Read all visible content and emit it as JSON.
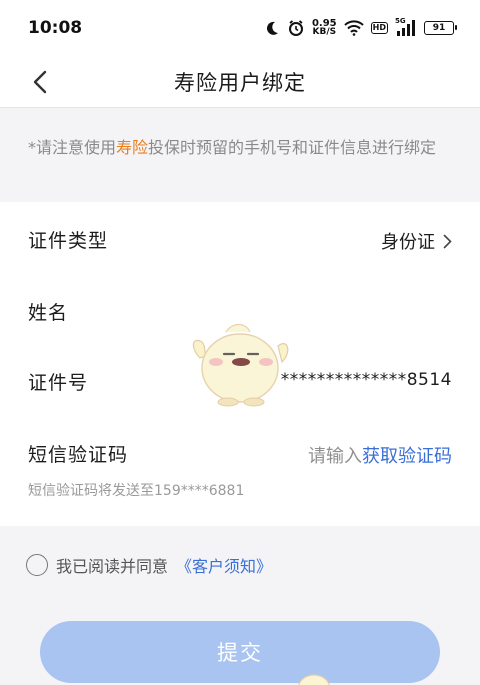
{
  "status_bar": {
    "time": "10:08",
    "net_speed_value": "0.95",
    "net_speed_unit": "KB/S",
    "hd_label": "HD",
    "signal_label": "5G",
    "battery": "91",
    "icons": [
      "moon-icon",
      "alarm-icon",
      "wifi-icon",
      "signal-icon",
      "battery-icon"
    ]
  },
  "nav": {
    "title": "寿险用户绑定",
    "back_icon": "chevron-left-icon"
  },
  "notice": {
    "prefix": "*请注意使用",
    "highlight": "寿险",
    "suffix": "投保时预留的手机号和证件信息进行绑定"
  },
  "form": {
    "id_type": {
      "label": "证件类型",
      "value": "身份证"
    },
    "name": {
      "label": "姓名",
      "value": ""
    },
    "id_number": {
      "label": "证件号",
      "value": "**************8514"
    },
    "sms_code": {
      "label": "短信验证码",
      "placeholder": "请输入",
      "get_code": "获取验证码",
      "hint": "短信验证码将发送至159****6881"
    }
  },
  "agreement": {
    "text": "我已阅读并同意",
    "link": "《客户须知》"
  },
  "submit": {
    "label": "提交"
  },
  "colors": {
    "accent": "#3a6fd8",
    "highlight": "#e67e22",
    "submit_bg": "#a9c4f1"
  }
}
